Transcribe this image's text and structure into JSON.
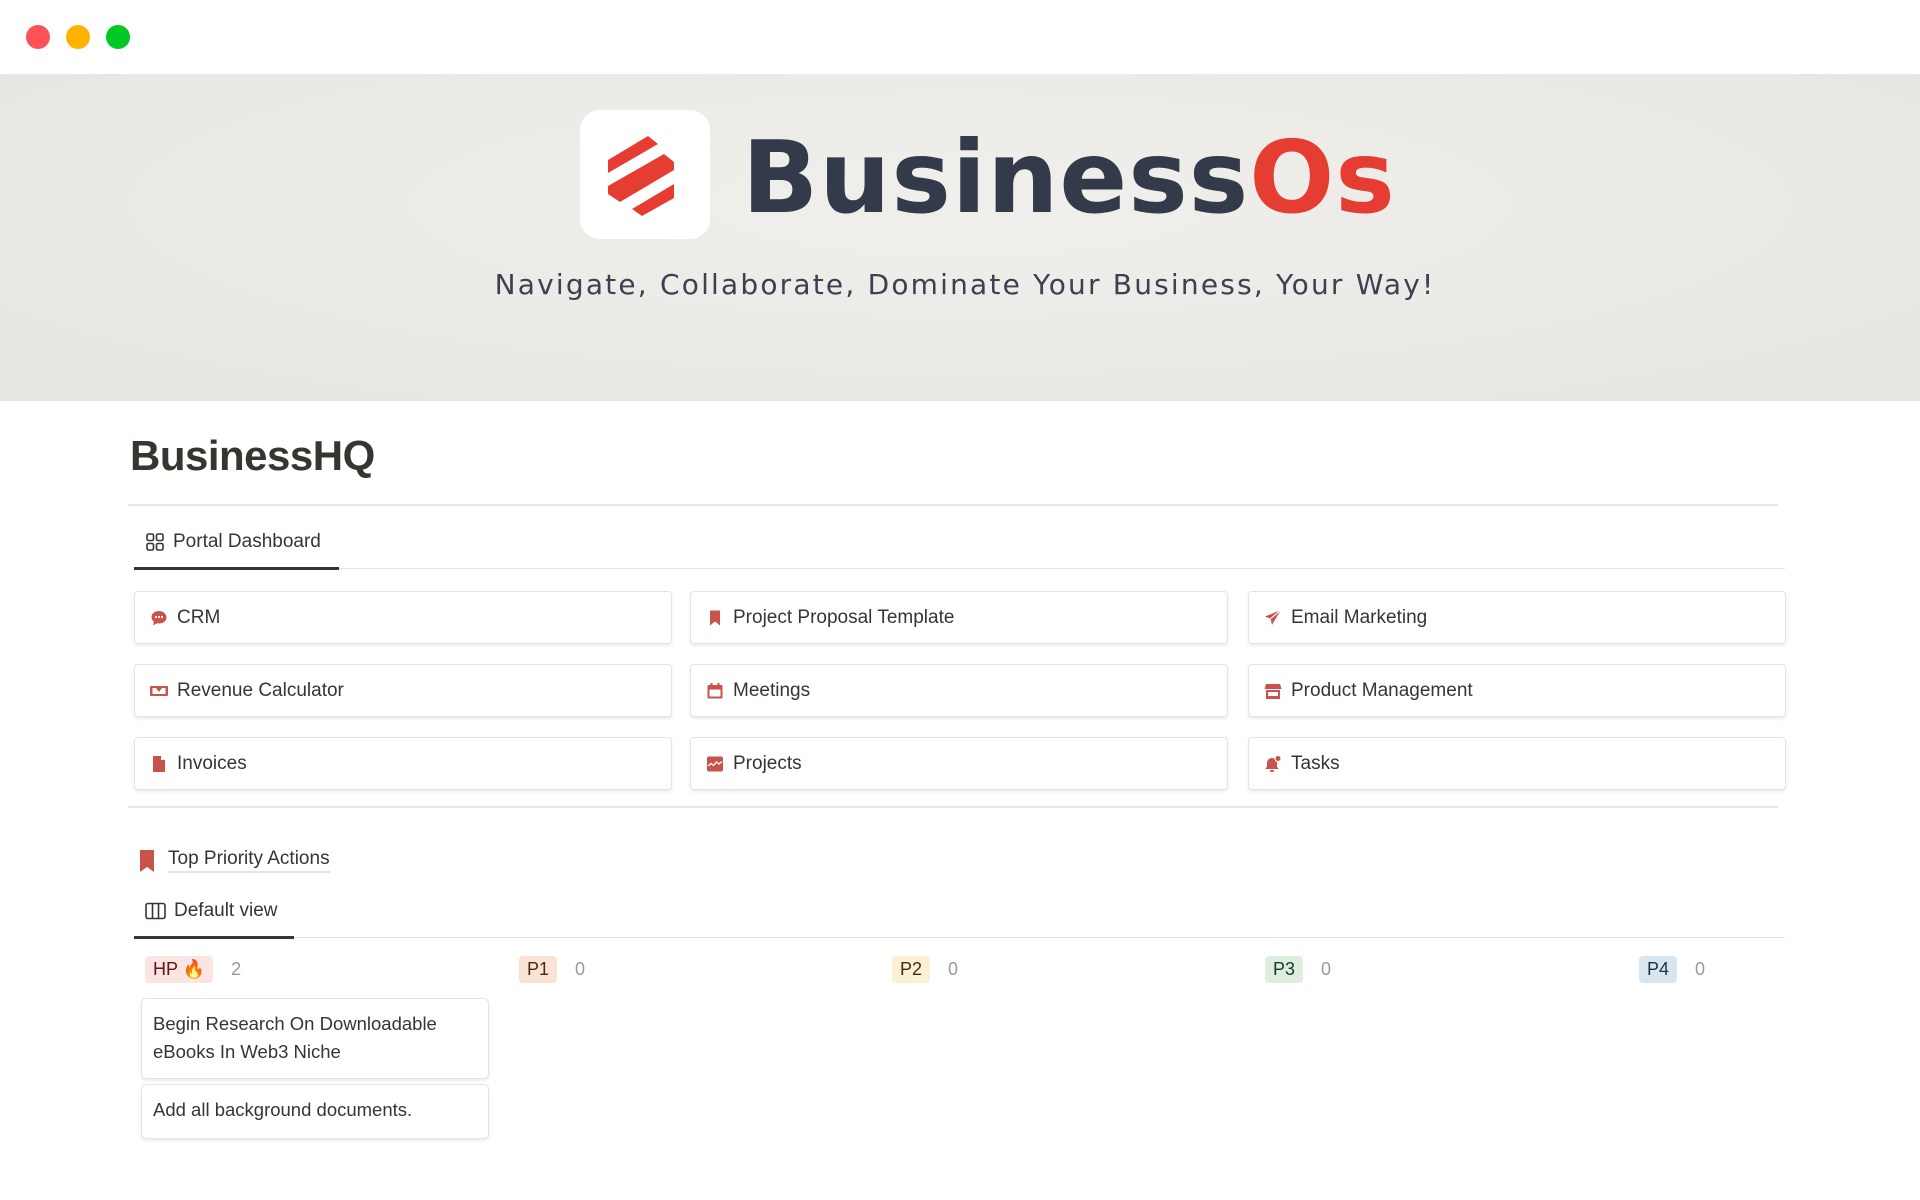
{
  "window": {
    "controls": [
      {
        "name": "close",
        "color": "#ff5257"
      },
      {
        "name": "minimize",
        "color": "#ffb300"
      },
      {
        "name": "zoom",
        "color": "#00c824"
      }
    ]
  },
  "banner": {
    "brand_main": "Business",
    "brand_accent": "Os",
    "tagline": "Navigate, Collaborate, Dominate Your Business, Your Way!",
    "logo_icon": "striped-hexagon-logo",
    "colors": {
      "brand_dark": "#333a4a",
      "brand_accent": "#e63d33"
    }
  },
  "page": {
    "title": "BusinessHQ"
  },
  "dashboard": {
    "tab_label": "Portal Dashboard",
    "tab_icon": "gallery-grid-icon",
    "icon_color": "#c9524a",
    "links": [
      {
        "label": "CRM",
        "icon": "chat-bubble-icon"
      },
      {
        "label": "Project Proposal Template",
        "icon": "bookmark-icon"
      },
      {
        "label": "Email Marketing",
        "icon": "paper-plane-icon"
      },
      {
        "label": "Revenue Calculator",
        "icon": "cash-icon"
      },
      {
        "label": "Meetings",
        "icon": "calendar-icon"
      },
      {
        "label": "Product Management",
        "icon": "storefront-icon"
      },
      {
        "label": "Invoices",
        "icon": "document-icon"
      },
      {
        "label": "Projects",
        "icon": "chart-line-icon"
      },
      {
        "label": "Tasks",
        "icon": "bell-notification-icon"
      }
    ]
  },
  "priority": {
    "title": "Top Priority Actions",
    "title_icon": "bookmark-icon",
    "view_label": "Default view",
    "view_icon": "board-columns-icon",
    "groups": [
      {
        "label": "HP 🔥",
        "count": "2",
        "bg": "#fbe4e4",
        "fg": "#5d1715",
        "cards": [
          "Begin Research On Downloadable eBooks In Web3 Niche",
          "Add all background documents."
        ]
      },
      {
        "label": "P1",
        "count": "0",
        "bg": "#fae3d4",
        "fg": "#49290e",
        "cards": []
      },
      {
        "label": "P2",
        "count": "0",
        "bg": "#fbf0d2",
        "fg": "#402c1b",
        "cards": []
      },
      {
        "label": "P3",
        "count": "0",
        "bg": "#ddeddf",
        "fg": "#1c3829",
        "cards": []
      },
      {
        "label": "P4",
        "count": "0",
        "bg": "#d9e6f0",
        "fg": "#183347",
        "cards": []
      }
    ]
  }
}
